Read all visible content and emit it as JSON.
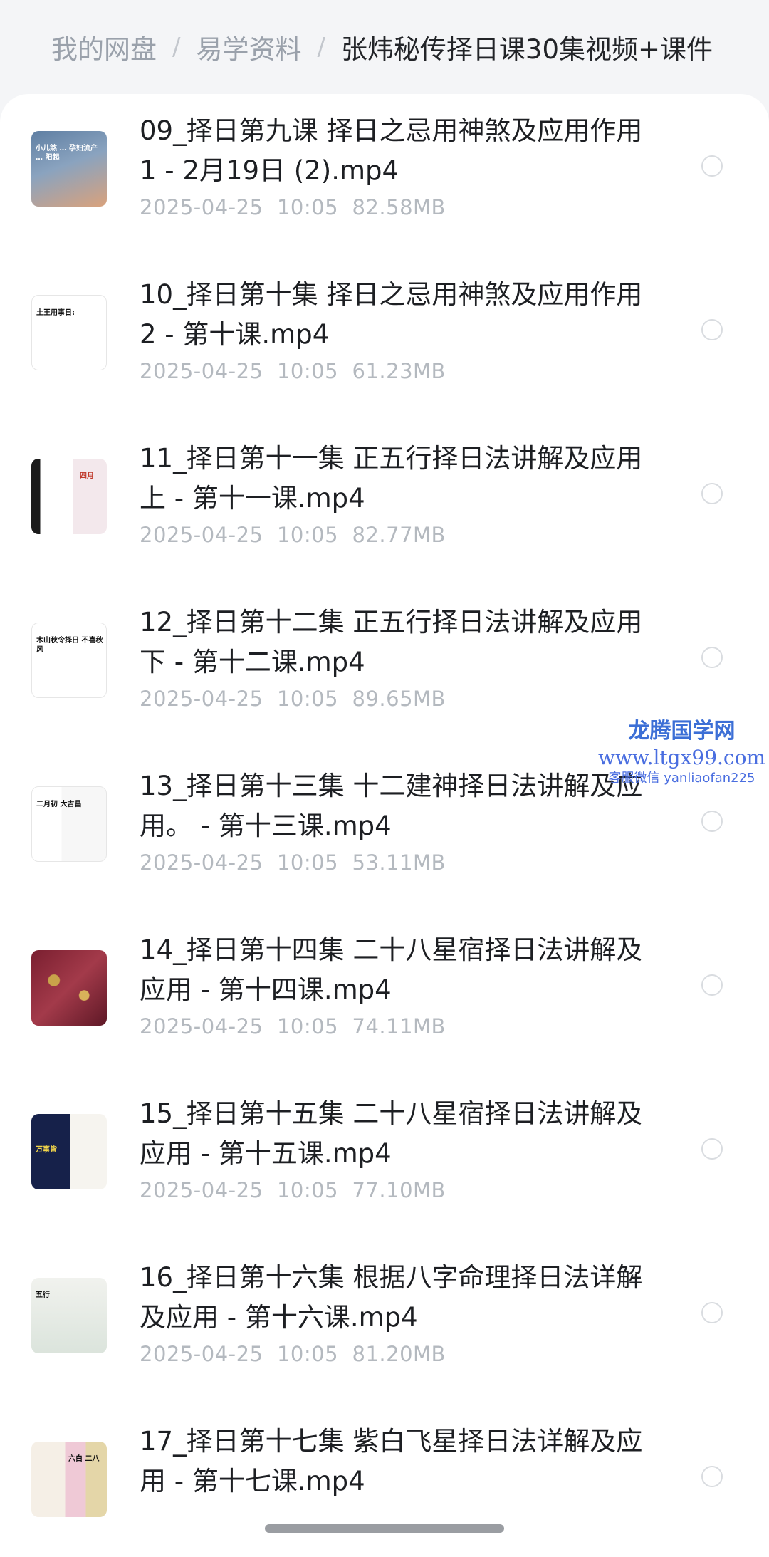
{
  "breadcrumb": {
    "items": [
      "我的网盘",
      "易学资料"
    ],
    "separator": "/",
    "current": "张炜秘传择日课30集视频+课件"
  },
  "files": [
    {
      "name": "09_择日第九课 择日之忌用神煞及应用作用1 - 2月19日 (2).mp4",
      "date": "2025-04-25",
      "time": "10:05",
      "size": "82.58MB"
    },
    {
      "name": "10_择日第十集 择日之忌用神煞及应用作用2 - 第十课.mp4",
      "date": "2025-04-25",
      "time": "10:05",
      "size": "61.23MB"
    },
    {
      "name": "11_择日第十一集 正五行择日法讲解及应用上 - 第十一课.mp4",
      "date": "2025-04-25",
      "time": "10:05",
      "size": "82.77MB"
    },
    {
      "name": "12_择日第十二集 正五行择日法讲解及应用下 - 第十二课.mp4",
      "date": "2025-04-25",
      "time": "10:05",
      "size": "89.65MB"
    },
    {
      "name": "13_择日第十三集 十二建神择日法讲解及应用。 - 第十三课.mp4",
      "date": "2025-04-25",
      "time": "10:05",
      "size": "53.11MB"
    },
    {
      "name": "14_择日第十四集 二十八星宿择日法讲解及应用 - 第十四课.mp4",
      "date": "2025-04-25",
      "time": "10:05",
      "size": "74.11MB"
    },
    {
      "name": "15_择日第十五集 二十八星宿择日法讲解及应用 - 第十五课.mp4",
      "date": "2025-04-25",
      "time": "10:05",
      "size": "77.10MB"
    },
    {
      "name": "16_择日第十六集 根据八字命理择日法详解及应用 - 第十六课.mp4",
      "date": "2025-04-25",
      "time": "10:05",
      "size": "81.20MB"
    },
    {
      "name": "17_择日第十七集 紫白飞星择日法详解及应用 - 第十七课.mp4",
      "date": "",
      "time": "",
      "size": ""
    }
  ],
  "thumbnails": [
    {
      "caption": "小儿煞 … 孕妇流产 … 阳起",
      "colors": [
        "#6f8aa8",
        "#d8a27a"
      ]
    },
    {
      "caption": "土王用事日:",
      "colors": [
        "#ffffff",
        "#ffffff"
      ]
    },
    {
      "caption": "四月",
      "colors": [
        "#ffffff",
        "#f2e6ea"
      ]
    },
    {
      "caption": "木山秋令择日 不喜秋风",
      "colors": [
        "#ffffff",
        "#ffffff"
      ]
    },
    {
      "caption": "二月初 大吉昌",
      "colors": [
        "#ffffff",
        "#fafafa"
      ]
    },
    {
      "caption": "",
      "colors": [
        "#8a2b3a",
        "#c9a34a"
      ]
    },
    {
      "caption": "万事皆",
      "colors": [
        "#16214a",
        "#f6f4ef"
      ]
    },
    {
      "caption": "五行",
      "colors": [
        "#eef0ec",
        "#dfe6df"
      ]
    },
    {
      "caption": "六白 二八",
      "colors": [
        "#f5efe6",
        "#e8b7c8"
      ]
    }
  ],
  "watermark": {
    "line1": "龙腾国学网",
    "line2": "www.ltgx99.com",
    "line3": "客服微信 yanliaofan225"
  },
  "colors": {
    "background": "#f4f5f7",
    "title_text": "#1d1f23",
    "meta_text": "#b4b9bf",
    "crumb_text": "#9aa1ab",
    "watermark": "#3c6fd6"
  }
}
